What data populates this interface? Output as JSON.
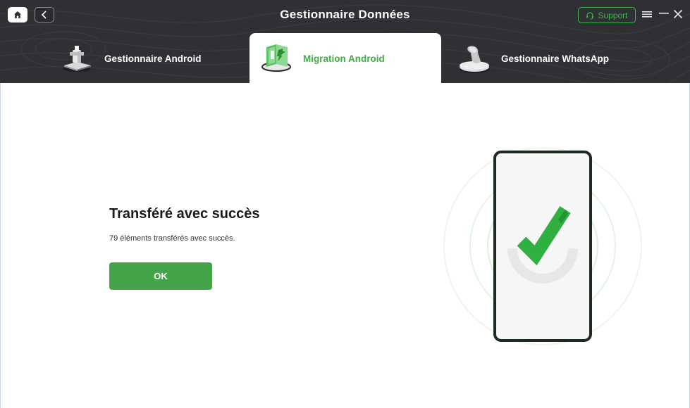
{
  "header": {
    "title": "Gestionnaire Données",
    "support_label": "Support"
  },
  "tabs": [
    {
      "label": "Gestionnaire Android",
      "active": false
    },
    {
      "label": "Migration Android",
      "active": true
    },
    {
      "label": "Gestionnaire WhatsApp",
      "active": false
    }
  ],
  "result": {
    "title": "Transféré avec succès",
    "message": "79 éléments transférés avec succès.",
    "ok_label": "OK"
  },
  "colors": {
    "header_bg": "#2f3033",
    "accent_green": "#3fae45",
    "button_green": "#43a44a"
  },
  "icons": {
    "home": "home-icon",
    "back": "chevron-left-icon",
    "support": "headset-icon",
    "menu": "menu-icon",
    "minimize": "minimize-icon",
    "close": "close-icon"
  }
}
